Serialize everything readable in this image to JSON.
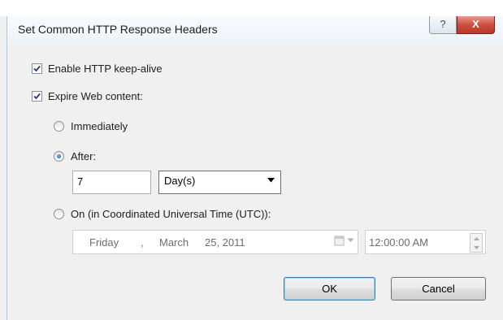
{
  "window": {
    "title": "Set Common HTTP Response Headers",
    "help_glyph": "?",
    "close_glyph": "X"
  },
  "options": {
    "keep_alive": {
      "label": "Enable HTTP keep-alive",
      "checked": true
    },
    "expire": {
      "label": "Expire Web content:",
      "checked": true
    }
  },
  "expire_mode": {
    "immediately": {
      "label": "Immediately",
      "selected": false
    },
    "after": {
      "label": "After:",
      "selected": true,
      "value": "7",
      "unit": "Day(s)"
    },
    "on": {
      "label": "On (in Coordinated Universal Time (UTC)):",
      "selected": false,
      "date": {
        "weekday": "Friday",
        "sep": ",",
        "month": "March",
        "day_year": "25, 2011"
      },
      "time": "12:00:00 AM"
    }
  },
  "buttons": {
    "ok": "OK",
    "cancel": "Cancel"
  },
  "colors": {
    "close_button": "#c94c3b",
    "accent": "#3c7fb1"
  },
  "icons": [
    "help-icon",
    "close-icon",
    "check-icon",
    "radio-dot-icon",
    "dropdown-arrow-icon",
    "calendar-icon",
    "spin-up-icon",
    "spin-down-icon"
  ]
}
